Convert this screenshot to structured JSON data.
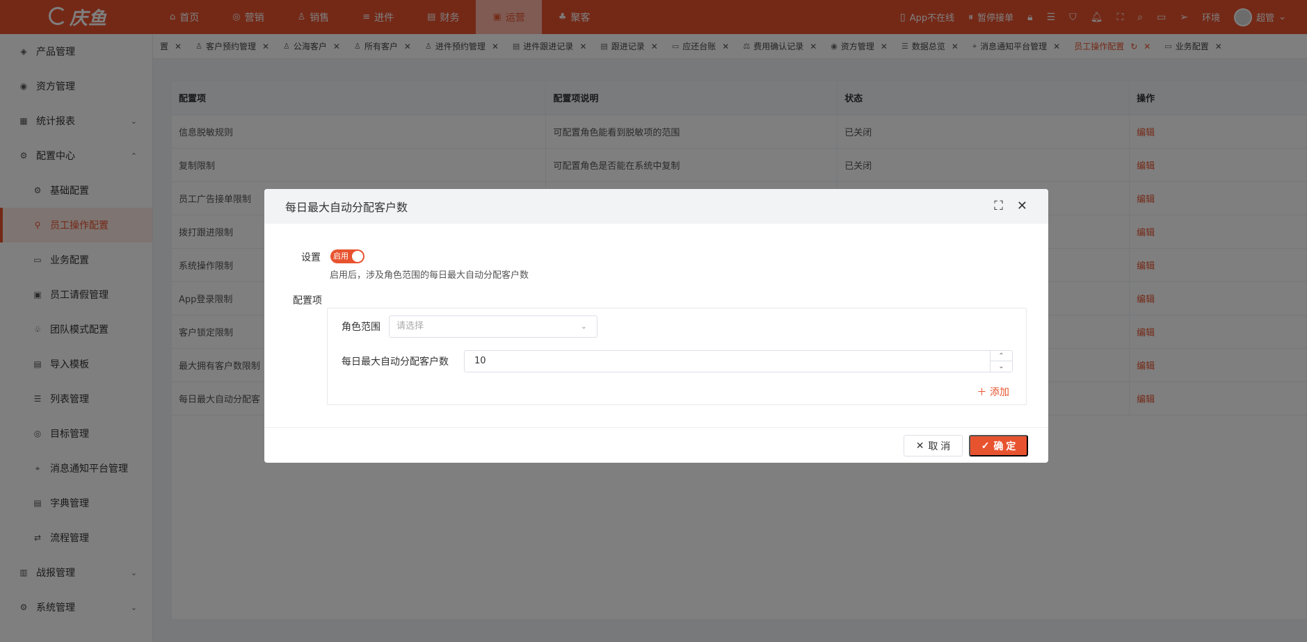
{
  "logo": {
    "text": "庆鱼"
  },
  "nav": [
    {
      "icon": "⌂",
      "label": "首页",
      "active": false
    },
    {
      "icon": "◎",
      "label": "营销",
      "active": false
    },
    {
      "icon": "♙",
      "label": "销售",
      "active": false
    },
    {
      "icon": "≡",
      "label": "进件",
      "active": false
    },
    {
      "icon": "▤",
      "label": "财务",
      "active": false
    },
    {
      "icon": "▣",
      "label": "运营",
      "active": true
    },
    {
      "icon": "♣",
      "label": "聚客",
      "active": false
    }
  ],
  "topRight": {
    "app_status": "App不在线",
    "pause": "暂停接单",
    "env": "环境",
    "user": "超管"
  },
  "sidebar": {
    "items": [
      {
        "icon": "◈",
        "label": "产品管理"
      },
      {
        "icon": "◉",
        "label": "资方管理"
      },
      {
        "icon": "▦",
        "label": "统计报表",
        "chev": "⌄"
      },
      {
        "icon": "⚙",
        "label": "配置中心",
        "chev": "⌃"
      }
    ],
    "sub": [
      {
        "icon": "⚙",
        "label": "基础配置",
        "active": false
      },
      {
        "icon": "⚲",
        "label": "员工操作配置",
        "active": true
      },
      {
        "icon": "▭",
        "label": "业务配置",
        "active": false
      },
      {
        "icon": "▣",
        "label": "员工请假管理",
        "active": false
      },
      {
        "icon": "♧",
        "label": "团队模式配置",
        "active": false
      },
      {
        "icon": "▤",
        "label": "导入模板",
        "active": false
      },
      {
        "icon": "☰",
        "label": "列表管理",
        "active": false
      },
      {
        "icon": "◎",
        "label": "目标管理",
        "active": false
      },
      {
        "icon": "⌖",
        "label": "消息通知平台管理",
        "active": false
      },
      {
        "icon": "▤",
        "label": "字典管理",
        "active": false
      },
      {
        "icon": "⇄",
        "label": "流程管理",
        "active": false
      }
    ],
    "bottom": [
      {
        "icon": "▥",
        "label": "战报管理",
        "chev": "⌄"
      },
      {
        "icon": "⚙",
        "label": "系统管理",
        "chev": "⌄"
      }
    ]
  },
  "tabs": [
    {
      "icon": "",
      "label": "置",
      "active": false
    },
    {
      "icon": "♙",
      "label": "客户预约管理",
      "active": false
    },
    {
      "icon": "♙",
      "label": "公海客户",
      "active": false
    },
    {
      "icon": "♙",
      "label": "所有客户",
      "active": false
    },
    {
      "icon": "♙",
      "label": "进件预约管理",
      "active": false
    },
    {
      "icon": "▤",
      "label": "进件跟进记录",
      "active": false
    },
    {
      "icon": "▤",
      "label": "跟进记录",
      "active": false
    },
    {
      "icon": "▭",
      "label": "应还台账",
      "active": false
    },
    {
      "icon": "⚖",
      "label": "费用确认记录",
      "active": false
    },
    {
      "icon": "◉",
      "label": "资方管理",
      "active": false
    },
    {
      "icon": "☰",
      "label": "数据总览",
      "active": false
    },
    {
      "icon": "⌖",
      "label": "消息通知平台管理",
      "active": false
    },
    {
      "icon": "",
      "label": "员工操作配置",
      "active": true
    },
    {
      "icon": "▭",
      "label": "业务配置",
      "active": false
    }
  ],
  "table": {
    "headers": [
      "配置项",
      "配置项说明",
      "状态",
      "操作"
    ],
    "rows": [
      {
        "item": "信息脱敏规则",
        "desc": "可配置角色能看到脱敏项的范围",
        "status": "已关闭",
        "action": "编辑"
      },
      {
        "item": "复制限制",
        "desc": "可配置角色是否能在系统中复制",
        "status": "已关闭",
        "action": "编辑"
      },
      {
        "item": "员工广告接单限制",
        "desc": "",
        "status": "",
        "action": "编辑"
      },
      {
        "item": "拨打跟进限制",
        "desc": "",
        "status": "",
        "action": "编辑"
      },
      {
        "item": "系统操作限制",
        "desc": "",
        "status": "",
        "action": "编辑"
      },
      {
        "item": "App登录限制",
        "desc": "",
        "status": "",
        "action": "编辑"
      },
      {
        "item": "客户锁定限制",
        "desc": "",
        "status": "",
        "action": "编辑"
      },
      {
        "item": "最大拥有客户数限制",
        "desc": "",
        "status": "",
        "action": "编辑"
      },
      {
        "item": "每日最大自动分配客",
        "desc": "",
        "status": "",
        "action": "编辑"
      }
    ]
  },
  "dialog": {
    "title": "每日最大自动分配客户数",
    "setting_label": "设置",
    "switch_text": "启用",
    "hint": "启用后，涉及角色范围的每日最大自动分配客户数",
    "config_label": "配置项",
    "role_label": "角色范围",
    "role_placeholder": "请选择",
    "max_label": "每日最大自动分配客户数",
    "max_value": "10",
    "add_label": "添加",
    "cancel_label": "取 消",
    "ok_label": "确 定"
  }
}
